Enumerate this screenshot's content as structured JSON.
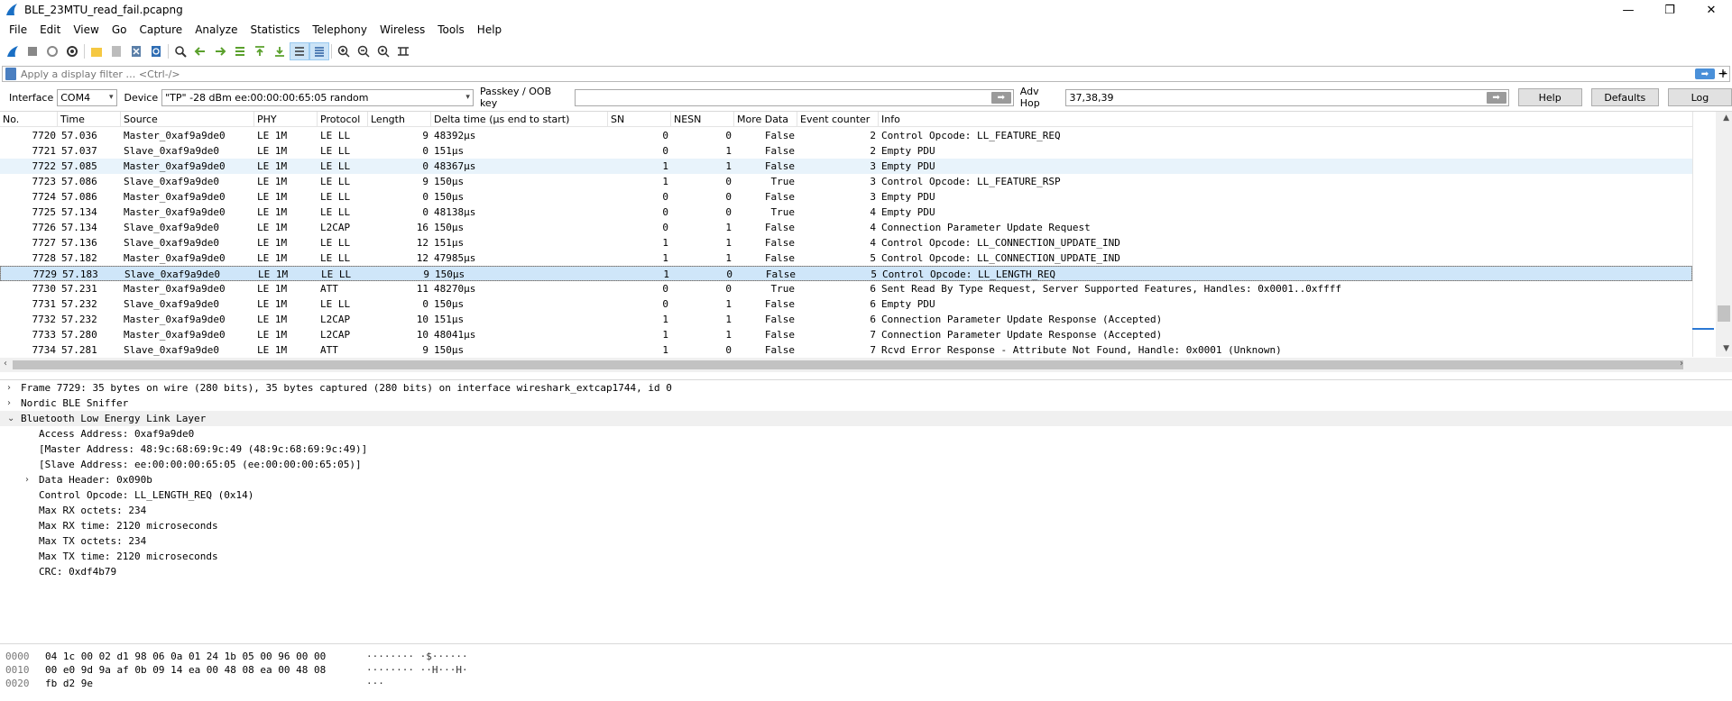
{
  "window": {
    "title": "BLE_23MTU_read_fail.pcapng",
    "controls": [
      "—",
      "❐",
      "✕"
    ]
  },
  "menu": [
    "File",
    "Edit",
    "View",
    "Go",
    "Capture",
    "Analyze",
    "Statistics",
    "Telephony",
    "Wireless",
    "Tools",
    "Help"
  ],
  "filter": {
    "placeholder": "Apply a display filter … <Ctrl-/>",
    "apply_glyph": "➡",
    "dropdown_glyph": "▾",
    "add_glyph": "+"
  },
  "sniffer": {
    "interface_label": "Interface",
    "interface_value": "COM4",
    "device_label": "Device",
    "device_value": "\"TP\"  -28 dBm  ee:00:00:00:65:05  random",
    "passkey_label": "Passkey / OOB key",
    "passkey_value": "",
    "adv_hop_label": "Adv Hop",
    "adv_hop_value": "37,38,39",
    "help_label": "Help",
    "defaults_label": "Defaults",
    "log_label": "Log",
    "go_glyph": "➡"
  },
  "packet_list": {
    "columns": [
      "No.",
      "Time",
      "Source",
      "PHY",
      "Protocol",
      "Length",
      "Delta time (µs end to start)",
      "SN",
      "NESN",
      "More Data",
      "Event counter",
      "Info"
    ],
    "rows": [
      {
        "no": "7720",
        "time": "57.036",
        "source": "Master_0xaf9a9de0",
        "phy": "LE 1M",
        "protocol": "LE LL",
        "length": "9",
        "delta": "48392µs",
        "sn": "0",
        "nesn": "0",
        "more": "False",
        "event": "2",
        "info": "Control Opcode: LL_FEATURE_REQ"
      },
      {
        "no": "7721",
        "time": "57.037",
        "source": "Slave_0xaf9a9de0",
        "phy": "LE 1M",
        "protocol": "LE LL",
        "length": "0",
        "delta": "151µs",
        "sn": "0",
        "nesn": "1",
        "more": "False",
        "event": "2",
        "info": "Empty PDU"
      },
      {
        "no": "7722",
        "time": "57.085",
        "source": "Master_0xaf9a9de0",
        "phy": "LE 1M",
        "protocol": "LE LL",
        "length": "0",
        "delta": "48367µs",
        "sn": "1",
        "nesn": "1",
        "more": "False",
        "event": "3",
        "info": "Empty PDU"
      },
      {
        "no": "7723",
        "time": "57.086",
        "source": "Slave_0xaf9a9de0",
        "phy": "LE 1M",
        "protocol": "LE LL",
        "length": "9",
        "delta": "150µs",
        "sn": "1",
        "nesn": "0",
        "more": "True",
        "event": "3",
        "info": "Control Opcode: LL_FEATURE_RSP"
      },
      {
        "no": "7724",
        "time": "57.086",
        "source": "Master_0xaf9a9de0",
        "phy": "LE 1M",
        "protocol": "LE LL",
        "length": "0",
        "delta": "150µs",
        "sn": "0",
        "nesn": "0",
        "more": "False",
        "event": "3",
        "info": "Empty PDU"
      },
      {
        "no": "7725",
        "time": "57.134",
        "source": "Master_0xaf9a9de0",
        "phy": "LE 1M",
        "protocol": "LE LL",
        "length": "0",
        "delta": "48138µs",
        "sn": "0",
        "nesn": "0",
        "more": "True",
        "event": "4",
        "info": "Empty PDU"
      },
      {
        "no": "7726",
        "time": "57.134",
        "source": "Slave_0xaf9a9de0",
        "phy": "LE 1M",
        "protocol": "L2CAP",
        "length": "16",
        "delta": "150µs",
        "sn": "0",
        "nesn": "1",
        "more": "False",
        "event": "4",
        "info": "Connection Parameter Update Request"
      },
      {
        "no": "7727",
        "time": "57.136",
        "source": "Slave_0xaf9a9de0",
        "phy": "LE 1M",
        "protocol": "LE LL",
        "length": "12",
        "delta": "151µs",
        "sn": "1",
        "nesn": "1",
        "more": "False",
        "event": "4",
        "info": "Control Opcode: LL_CONNECTION_UPDATE_IND"
      },
      {
        "no": "7728",
        "time": "57.182",
        "source": "Master_0xaf9a9de0",
        "phy": "LE 1M",
        "protocol": "LE LL",
        "length": "12",
        "delta": "47985µs",
        "sn": "1",
        "nesn": "1",
        "more": "False",
        "event": "5",
        "info": "Control Opcode: LL_CONNECTION_UPDATE_IND"
      },
      {
        "no": "7729",
        "time": "57.183",
        "source": "Slave_0xaf9a9de0",
        "phy": "LE 1M",
        "protocol": "LE LL",
        "length": "9",
        "delta": "150µs",
        "sn": "1",
        "nesn": "0",
        "more": "False",
        "event": "5",
        "info": "Control Opcode: LL_LENGTH_REQ"
      },
      {
        "no": "7730",
        "time": "57.231",
        "source": "Master_0xaf9a9de0",
        "phy": "LE 1M",
        "protocol": "ATT",
        "length": "11",
        "delta": "48270µs",
        "sn": "0",
        "nesn": "0",
        "more": "True",
        "event": "6",
        "info": "Sent Read By Type Request, Server Supported Features, Handles: 0x0001..0xffff"
      },
      {
        "no": "7731",
        "time": "57.232",
        "source": "Slave_0xaf9a9de0",
        "phy": "LE 1M",
        "protocol": "LE LL",
        "length": "0",
        "delta": "150µs",
        "sn": "0",
        "nesn": "1",
        "more": "False",
        "event": "6",
        "info": "Empty PDU"
      },
      {
        "no": "7732",
        "time": "57.232",
        "source": "Master_0xaf9a9de0",
        "phy": "LE 1M",
        "protocol": "L2CAP",
        "length": "10",
        "delta": "151µs",
        "sn": "1",
        "nesn": "1",
        "more": "False",
        "event": "6",
        "info": "Connection Parameter Update Response (Accepted)"
      },
      {
        "no": "7733",
        "time": "57.280",
        "source": "Master_0xaf9a9de0",
        "phy": "LE 1M",
        "protocol": "L2CAP",
        "length": "10",
        "delta": "48041µs",
        "sn": "1",
        "nesn": "1",
        "more": "False",
        "event": "7",
        "info": "Connection Parameter Update Response (Accepted)"
      },
      {
        "no": "7734",
        "time": "57.281",
        "source": "Slave_0xaf9a9de0",
        "phy": "LE 1M",
        "protocol": "ATT",
        "length": "9",
        "delta": "150µs",
        "sn": "1",
        "nesn": "0",
        "more": "False",
        "event": "7",
        "info": "Rcvd Error Response - Attribute Not Found, Handle: 0x0001 (Unknown)"
      }
    ],
    "selected_row": "7729"
  },
  "details": [
    {
      "text": "Frame 7729: 35 bytes on wire (280 bits), 35 bytes captured (280 bits) on interface wireshark_extcap1744, id 0",
      "twisty": "›"
    },
    {
      "text": "Nordic BLE Sniffer",
      "twisty": "›"
    },
    {
      "text": "Bluetooth Low Energy Link Layer",
      "twisty": "⌄"
    },
    {
      "text": "Access Address: 0xaf9a9de0",
      "twisty": ""
    },
    {
      "text": "[Master Address: 48:9c:68:69:9c:49 (48:9c:68:69:9c:49)]",
      "twisty": ""
    },
    {
      "text": "[Slave Address: ee:00:00:00:65:05 (ee:00:00:00:65:05)]",
      "twisty": ""
    },
    {
      "text": "Data Header: 0x090b",
      "twisty": "›"
    },
    {
      "text": "Control Opcode: LL_LENGTH_REQ (0x14)",
      "twisty": ""
    },
    {
      "text": "Max RX octets: 234",
      "twisty": ""
    },
    {
      "text": "Max RX time: 2120 microseconds",
      "twisty": ""
    },
    {
      "text": "Max TX octets: 234",
      "twisty": ""
    },
    {
      "text": "Max TX time: 2120 microseconds",
      "twisty": ""
    },
    {
      "text": "CRC: 0xdf4b79",
      "twisty": ""
    }
  ],
  "bytes": [
    {
      "offset": "0000",
      "hex": "04 1c 00 02 d1 98 06 0a  01 24 1b 05 00 96 00 00",
      "ascii": "········ ·$······"
    },
    {
      "offset": "0010",
      "hex": "00 e0 9d 9a af 0b 09 14  ea 00 48 08 ea 00 48 08",
      "ascii": "········ ··H···H·"
    },
    {
      "offset": "0020",
      "hex": "fb d2 9e",
      "ascii": "···"
    }
  ],
  "colors": {
    "alt_row": "#e8f3fb",
    "selected_row": "#cfe6f9",
    "accent": "#2b78d4"
  }
}
